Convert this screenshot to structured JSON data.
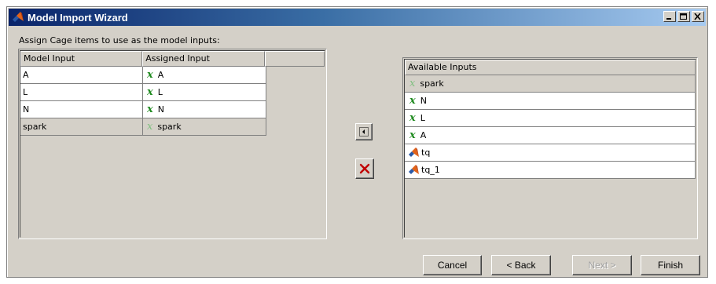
{
  "window": {
    "title": "Model Import Wizard",
    "buttons": [
      "minimize-icon",
      "maximize-icon",
      "close-icon"
    ]
  },
  "instruction": "Assign Cage items to use as the model inputs:",
  "assigned_table": {
    "headers": [
      "Model Input",
      "Assigned Input",
      ""
    ],
    "rows": [
      {
        "model_input": "A",
        "assigned": "A",
        "selected": false
      },
      {
        "model_input": "L",
        "assigned": "L",
        "selected": false
      },
      {
        "model_input": "N",
        "assigned": "N",
        "selected": false
      },
      {
        "model_input": "spark",
        "assigned": "spark",
        "selected": true
      }
    ],
    "var_symbol": "x"
  },
  "middle_buttons": {
    "assign_icon": "arrow-left-icon",
    "remove_icon": "red-x-delete-icon"
  },
  "available_table": {
    "header": "Available Inputs",
    "rows": [
      {
        "label": "spark",
        "kind": "variable",
        "selected": true
      },
      {
        "label": "N",
        "kind": "variable",
        "selected": false
      },
      {
        "label": "L",
        "kind": "variable",
        "selected": false
      },
      {
        "label": "A",
        "kind": "variable",
        "selected": false
      },
      {
        "label": "tq",
        "kind": "model",
        "selected": false
      },
      {
        "label": "tq_1",
        "kind": "model",
        "selected": false
      }
    ],
    "var_symbol": "x"
  },
  "footer": {
    "cancel": "Cancel",
    "back": "< Back",
    "next": "Next >",
    "finish": "Finish"
  },
  "colors": {
    "title_gradient_start": "#0a246a",
    "title_gradient_end": "#a6caf0",
    "face": "#d4d0c8",
    "variable_green": "#1f8a1f",
    "delete_red": "#c00000"
  }
}
